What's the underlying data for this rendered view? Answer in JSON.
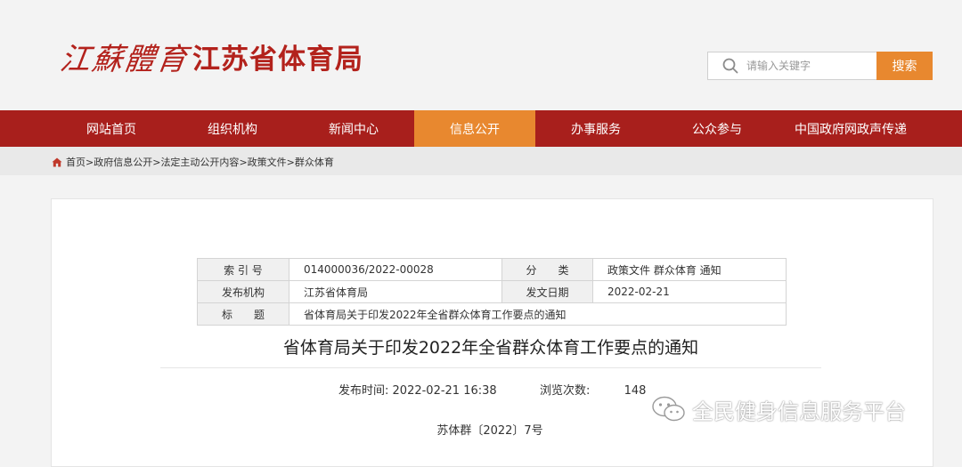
{
  "header": {
    "logo_calligraphy": "江蘇體育",
    "logo_name": "江苏省体育局"
  },
  "search": {
    "placeholder": "请输入关键字",
    "button_label": "搜索"
  },
  "nav": {
    "items": [
      {
        "label": "网站首页"
      },
      {
        "label": "组织机构"
      },
      {
        "label": "新闻中心"
      },
      {
        "label": "信息公开",
        "active": true
      },
      {
        "label": "办事服务"
      },
      {
        "label": "公众参与"
      },
      {
        "label": "中国政府网政声传递"
      }
    ]
  },
  "breadcrumb": {
    "items": [
      "首页",
      "政府信息公开",
      "法定主动公开内容",
      "政策文件",
      "群众体育"
    ],
    "separator": ">"
  },
  "meta": {
    "index_label": "索 引 号",
    "index_value": "014000036/2022-00028",
    "category_label": "分　　类",
    "category_value": "政策文件 群众体育 通知",
    "publisher_label": "发布机构",
    "publisher_value": "江苏省体育局",
    "date_label": "发文日期",
    "date_value": "2022-02-21",
    "subject_label": "标　　题",
    "subject_value": "省体育局关于印发2022年全省群众体育工作要点的通知"
  },
  "article": {
    "title": "省体育局关于印发2022年全省群众体育工作要点的通知",
    "publish_time_label": "发布时间:",
    "publish_time": "2022-02-21 16:38",
    "views_label": "浏览次数:",
    "views": "148",
    "doc_number": "苏体群〔2022〕7号"
  },
  "watermark": {
    "text": "全民健身信息服务平台",
    "icon": "wechat-icon"
  },
  "colors": {
    "brand_red": "#a81f1c",
    "accent_orange": "#e8882f",
    "logo_red": "#b3221c"
  }
}
